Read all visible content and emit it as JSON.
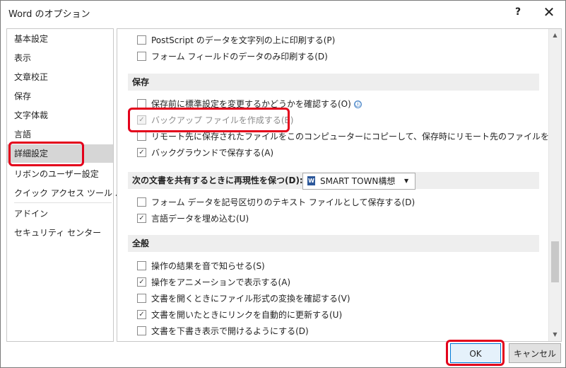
{
  "window": {
    "title": "Word のオプション",
    "help_label": "?",
    "close_label": "✕"
  },
  "sidebar": {
    "items": [
      {
        "label": "基本設定"
      },
      {
        "label": "表示"
      },
      {
        "label": "文章校正"
      },
      {
        "label": "保存"
      },
      {
        "label": "文字体裁"
      },
      {
        "label": "言語"
      },
      {
        "label": "詳細設定",
        "selected": true
      },
      {
        "label": "リボンのユーザー設定"
      },
      {
        "label": "クイック アクセス ツール バー"
      },
      {
        "label": "アドイン"
      },
      {
        "label": "セキュリティ センター"
      }
    ]
  },
  "content": {
    "print_options": [
      {
        "label": "PostScript のデータを文字列の上に印刷する(P)",
        "checked": false
      },
      {
        "label": "フォーム フィールドのデータのみ印刷する(D)",
        "checked": false
      }
    ],
    "save_section": {
      "heading": "保存",
      "options": [
        {
          "label": "保存前に標準設定を変更するかどうかを確認する(O)",
          "checked": false,
          "info_icon": "ⓘ"
        },
        {
          "label": "バックアップ ファイルを作成する(B)",
          "checked": true,
          "disabled": true
        },
        {
          "label": "リモート先に保存されたファイルをこのコンピューターにコピーして、保存時にリモート先のファイルを更新する(E)",
          "checked": false
        },
        {
          "label": "バックグラウンドで保存する(A)",
          "checked": true
        }
      ]
    },
    "share_section": {
      "heading": "次の文書を共有するときに再現性を保つ(D):",
      "document_select": "SMART TOWN構想",
      "word_icon": "W",
      "caret": "▼",
      "options": [
        {
          "label": "フォーム データを記号区切りのテキスト ファイルとして保存する(D)",
          "checked": false
        },
        {
          "label": "言語データを埋め込む(U)",
          "checked": true
        }
      ]
    },
    "general_section": {
      "heading": "全般",
      "options": [
        {
          "label": "操作の結果を音で知らせる(S)",
          "checked": false
        },
        {
          "label": "操作をアニメーションで表示する(A)",
          "checked": true
        },
        {
          "label": "文書を開くときにファイル形式の変換を確認する(V)",
          "checked": false
        },
        {
          "label": "文書を開いたときにリンクを自動的に更新する(U)",
          "checked": true
        },
        {
          "label": "文書を下書き表示で開けるようにする(D)",
          "checked": false
        }
      ]
    },
    "scrollbar": {
      "up": "▲",
      "down": "▼"
    }
  },
  "buttons": {
    "ok": "OK",
    "cancel": "キャンセル"
  },
  "colors": {
    "highlight": "#e3001b",
    "selected_nav": "#d6d6d6",
    "ok_border": "#0078d7"
  }
}
